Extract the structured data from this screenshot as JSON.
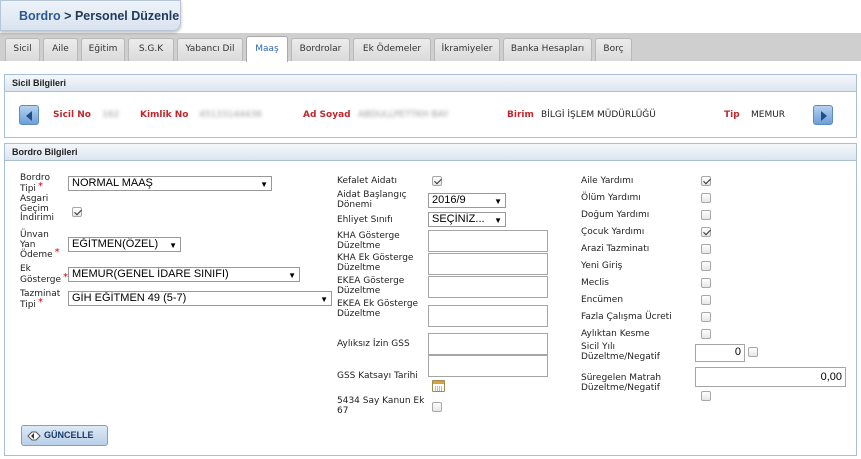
{
  "breadcrumb": {
    "root": "Bordro",
    "separator": ">",
    "current": "Personel Düzenle"
  },
  "tabs": [
    "Sicil",
    "Aile",
    "Eğitim",
    "S.G.K",
    "Yabancı Dil",
    "Maaş",
    "Bordrolar",
    "Ek Ödemeler",
    "İkramiyeler",
    "Banka Hesapları",
    "Borç"
  ],
  "active_tab": "Maaş",
  "sicil": {
    "title": "Sicil Bilgileri",
    "sicil_no_label": "Sicil No",
    "sicil_no_value": "162",
    "kimlik_no_label": "Kimlik No",
    "kimlik_no_value": "45133144436",
    "ad_soyad_label": "Ad Soyad",
    "ad_soyad_value": "ABDULLPETTKH BAY",
    "birim_label": "Birim",
    "birim_value": "BİLGİ İŞLEM MÜDÜRLÜĞÜ",
    "tip_label": "Tip",
    "tip_value": "MEMUR"
  },
  "bordro": {
    "title": "Bordro Bilgileri",
    "left": {
      "bordro_tipi_label": "Bordro Tipi",
      "bordro_tipi_value": "NORMAL MAAŞ",
      "asgari_label": "Asgari Geçim İndirimi",
      "unvan_label": "Ünvan Yan Ödeme",
      "unvan_value": "EĞİTMEN(ÖZEL)",
      "ek_gosterge_label": "Ek Gösterge",
      "ek_gosterge_value": "MEMUR(GENEL İDARE SINIFI)",
      "tazminat_label": "Tazminat Tipi",
      "tazminat_value": "GİH EĞİTMEN 49 (5-7)"
    },
    "mid": {
      "kefalet_label": "Kefalet Aidatı",
      "aidat_label": "Aidat Başlangıç Dönemi",
      "aidat_value": "2016/9",
      "ehliyet_label": "Ehliyet Sınıfı",
      "ehliyet_value": "SEÇİNİZ...",
      "kha_label": "KHA Gösterge Düzeltme",
      "kha_ek_label": "KHA Ek Gösterge Düzeltme",
      "ekea_label": "EKEA Gösterge Düzeltme",
      "ekea_ek_label": "EKEA Ek Gösterge Düzeltme",
      "ayliksiz_label": "Aylıksız İzin GSS",
      "gss_label": "GSS Katsayı Tarihi",
      "kanun_label": "5434 Say Kanun Ek 67"
    },
    "right": {
      "aile": "Aile Yardımı",
      "olum": "Ölüm Yardımı",
      "dogum": "Doğum Yardımı",
      "cocuk": "Çocuk Yardımı",
      "arazi": "Arazi Tazminatı",
      "yeni": "Yeni Giriş",
      "meclis": "Meclis",
      "encumen": "Encümen",
      "fazla": "Fazla Çalışma Ücreti",
      "ayliktan": "Aylıktan Kesme",
      "sicil_yili_label": "Sicil Yılı Düzeltme/Negatif",
      "sicil_yili_value": "0",
      "suregelen_label": "Süregelen Matrah Düzeltme/Negatif",
      "suregelen_value": "0,00"
    },
    "button": "GÜNCELLE"
  }
}
